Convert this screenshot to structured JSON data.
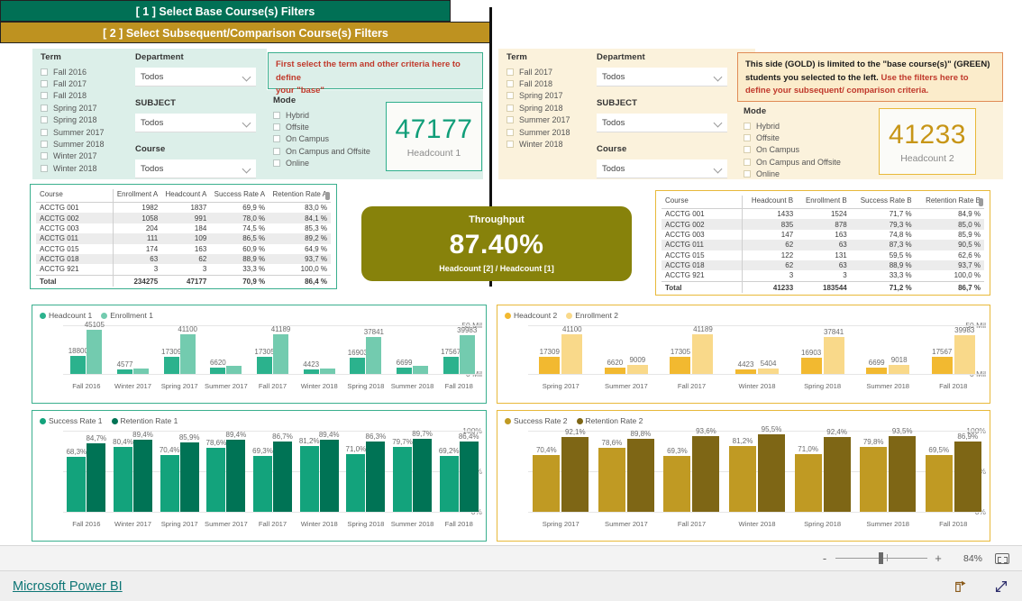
{
  "left_panel": {
    "header": "[ 1 ] Select Base Course(s) Filters",
    "term_label": "Term",
    "terms": [
      "Fall 2016",
      "Fall 2017",
      "Fall 2018",
      "Spring 2017",
      "Spring 2018",
      "Summer 2017",
      "Summer 2018",
      "Winter 2017",
      "Winter 2018"
    ],
    "department_label": "Department",
    "department_value": "Todos",
    "subject_label": "SUBJECT",
    "subject_value": "Todos",
    "course_label": "Course",
    "course_value": "Todos",
    "mode_label": "Mode",
    "modes": [
      "Hybrid",
      "Offsite",
      "On Campus",
      "On Campus and Offsite",
      "Online"
    ],
    "note_line1": "First select the term and other criteria here to define",
    "note_line2": "your \"base\"",
    "kpi_value": "47177",
    "kpi_caption": "Headcount 1"
  },
  "right_panel": {
    "header": "[ 2 ] Select Subsequent/Comparison Course(s) Filters",
    "term_label": "Term",
    "terms": [
      "Fall 2017",
      "Fall 2018",
      "Spring 2017",
      "Spring 2018",
      "Summer 2017",
      "Summer 2018",
      "Winter 2018"
    ],
    "department_label": "Department",
    "department_value": "Todos",
    "subject_label": "SUBJECT",
    "subject_value": "Todos",
    "course_label": "Course",
    "course_value": "Todos",
    "mode_label": "Mode",
    "modes": [
      "Hybrid",
      "Offsite",
      "On Campus",
      "On Campus and Offsite",
      "Online"
    ],
    "note_line1": "This side (GOLD) is limited to the \"base course(s)\" (GREEN)",
    "note_line2_a": "students you selected to the left.",
    "note_line2_b": "Use the filters here to",
    "note_line3": "define your subsequent/ comparison criteria.",
    "kpi_value": "41233",
    "kpi_caption": "Headcount 2"
  },
  "throughput": {
    "title": "Throughput",
    "value": "87.40%",
    "subtitle": "Headcount [2] / Headcount [1]"
  },
  "table_a": {
    "headers": [
      "Course",
      "Enrollment A",
      "Headcount A",
      "Success Rate A",
      "Retention Rate A"
    ],
    "rows": [
      [
        "ACCTG 001",
        "1982",
        "1837",
        "69,9 %",
        "83,0 %"
      ],
      [
        "ACCTG 002",
        "1058",
        "991",
        "78,0 %",
        "84,1 %"
      ],
      [
        "ACCTG 003",
        "204",
        "184",
        "74,5 %",
        "85,3 %"
      ],
      [
        "ACCTG 011",
        "111",
        "109",
        "86,5 %",
        "89,2 %"
      ],
      [
        "ACCTG 015",
        "174",
        "163",
        "60,9 %",
        "64,9 %"
      ],
      [
        "ACCTG 018",
        "63",
        "62",
        "88,9 %",
        "93,7 %"
      ],
      [
        "ACCTG 921",
        "3",
        "3",
        "33,3 %",
        "100,0 %"
      ]
    ],
    "total": [
      "Total",
      "234275",
      "47177",
      "70,9 %",
      "86,4 %"
    ]
  },
  "table_b": {
    "headers": [
      "Course",
      "Headcount B",
      "Enrollment B",
      "Success Rate B",
      "Retention Rate B"
    ],
    "rows": [
      [
        "ACCTG 001",
        "1433",
        "1524",
        "71,7 %",
        "84,9 %"
      ],
      [
        "ACCTG 002",
        "835",
        "878",
        "79,3 %",
        "85,0 %"
      ],
      [
        "ACCTG 003",
        "147",
        "163",
        "74,8 %",
        "85,9 %"
      ],
      [
        "ACCTG 011",
        "62",
        "63",
        "87,3 %",
        "90,5 %"
      ],
      [
        "ACCTG 015",
        "122",
        "131",
        "59,5 %",
        "62,6 %"
      ],
      [
        "ACCTG 018",
        "62",
        "63",
        "88,9 %",
        "93,7 %"
      ],
      [
        "ACCTG 921",
        "3",
        "3",
        "33,3 %",
        "100,0 %"
      ]
    ],
    "total": [
      "Total",
      "41233",
      "183544",
      "71,2 %",
      "86,7 %"
    ]
  },
  "status_bar": {
    "zoom_minus": "-",
    "zoom_plus": "+",
    "zoom_level": "84%"
  },
  "footer": {
    "brand": "Microsoft Power BI"
  },
  "colors": {
    "green_header": "#017055",
    "gold_header": "#BE9220",
    "green_fill_light": "#DCEFE9",
    "gold_fill_light": "#FBF2DC",
    "headcount1": "#2BB28D",
    "enrollment1": "#73CBAF",
    "headcount2": "#F2B930",
    "enrollment2": "#F9D98A",
    "success1": "#13A37C",
    "retention1": "#007355",
    "success2": "#C09A23",
    "retention2": "#7E6615",
    "throughput_bg": "#87820B"
  },
  "chart_data": [
    {
      "type": "bar",
      "title": "Headcount 1 / Enrollment 1",
      "categories": [
        "Fall 2016",
        "Winter 2017",
        "Spring 2017",
        "Summer 2017",
        "Fall 2017",
        "Winter 2018",
        "Spring 2018",
        "Summer 2018",
        "Fall 2018"
      ],
      "series": [
        {
          "name": "Headcount 1",
          "color": "#2BB28D",
          "values": [
            18800,
            4577,
            17309,
            6620,
            17305,
            4423,
            16903,
            6699,
            17567
          ]
        },
        {
          "name": "Enrollment 1",
          "color": "#73CBAF",
          "values": [
            45105,
            5400,
            41100,
            8100,
            41189,
            5300,
            37841,
            8100,
            39983
          ]
        }
      ],
      "visible_labels": {
        "Headcount 1": [
          "18800",
          "4577",
          "17309",
          "6620",
          "17305",
          "4423",
          "16903",
          "6699",
          "17567"
        ],
        "Enrollment 1": [
          "45105",
          "",
          "41100",
          "",
          "41189",
          "",
          "37841",
          "",
          "39983"
        ]
      },
      "ylabel": "",
      "xlabel": "",
      "yticks": [
        "0 Mil",
        "50 Mil"
      ],
      "ylim": [
        0,
        50000
      ],
      "grid": true,
      "legend": "top-left"
    },
    {
      "type": "bar",
      "title": "Headcount 2 / Enrollment 2",
      "categories": [
        "Spring 2017",
        "Summer 2017",
        "Fall 2017",
        "Winter 2018",
        "Spring 2018",
        "Summer 2018",
        "Fall 2018"
      ],
      "series": [
        {
          "name": "Headcount 2",
          "color": "#F2B930",
          "values": [
            17309,
            6620,
            17305,
            4423,
            16903,
            6699,
            17567
          ]
        },
        {
          "name": "Enrollment 2",
          "color": "#F9D98A",
          "values": [
            41100,
            9009,
            41189,
            5404,
            37841,
            9018,
            39983
          ]
        }
      ],
      "visible_labels": {
        "Headcount 2": [
          "17309",
          "6620",
          "17305",
          "4423",
          "16903",
          "6699",
          "17567"
        ],
        "Enrollment 2": [
          "41100",
          "9009",
          "41189",
          "5404",
          "37841",
          "9018",
          "39983"
        ]
      },
      "ylabel": "",
      "xlabel": "",
      "yticks": [
        "0 Mil",
        "50 Mil"
      ],
      "ylim": [
        0,
        50000
      ],
      "grid": true,
      "legend": "top-left"
    },
    {
      "type": "bar",
      "title": "Success Rate 1 / Retention Rate 1",
      "categories": [
        "Fall 2016",
        "Winter 2017",
        "Spring 2017",
        "Summer 2017",
        "Fall 2017",
        "Winter 2018",
        "Spring 2018",
        "Summer 2018",
        "Fall 2018"
      ],
      "series": [
        {
          "name": "Success Rate 1",
          "color": "#13A37C",
          "values": [
            68.3,
            80.4,
            70.4,
            78.6,
            69.3,
            81.2,
            71.0,
            79.7,
            69.2
          ]
        },
        {
          "name": "Retention Rate 1",
          "color": "#007355",
          "values": [
            84.7,
            89.4,
            85.9,
            89.4,
            86.7,
            89.4,
            86.3,
            89.7,
            86.4
          ]
        }
      ],
      "visible_labels": {
        "Success Rate 1": [
          "68,3%",
          "80,4%",
          "70,4%",
          "78,6%",
          "69,3%",
          "81,2%",
          "71,0%",
          "79,7%",
          "69,2%"
        ],
        "Retention Rate 1": [
          "84,7%",
          "89,4%",
          "85,9%",
          "89,4%",
          "86,7%",
          "89,4%",
          "86,3%",
          "89,7%",
          "86,4%"
        ]
      },
      "ylabel": "",
      "xlabel": "",
      "yticks": [
        "0%",
        "50%",
        "100%"
      ],
      "ylim": [
        0,
        100
      ],
      "grid": true,
      "legend": "top-left"
    },
    {
      "type": "bar",
      "title": "Success Rate 2 / Retention Rate 2",
      "categories": [
        "Spring 2017",
        "Summer 2017",
        "Fall 2017",
        "Winter 2018",
        "Spring 2018",
        "Summer 2018",
        "Fall 2018"
      ],
      "series": [
        {
          "name": "Success Rate 2",
          "color": "#C09A23",
          "values": [
            70.4,
            78.6,
            69.3,
            81.2,
            71.0,
            79.8,
            69.5
          ]
        },
        {
          "name": "Retention Rate 2",
          "color": "#7E6615",
          "values": [
            92.1,
            89.8,
            93.6,
            95.5,
            92.4,
            93.5,
            86.9
          ]
        }
      ],
      "visible_labels": {
        "Success Rate 2": [
          "70,4%",
          "78,6%",
          "69,3%",
          "81,2%",
          "71,0%",
          "79,8%",
          "69,5%"
        ],
        "Retention Rate 2": [
          "92,1%",
          "89,8%",
          "93,6%",
          "95,5%",
          "92,4%",
          "93,5%",
          "86,9%"
        ]
      },
      "ylabel": "",
      "xlabel": "",
      "yticks": [
        "0%",
        "50%",
        "100%"
      ],
      "ylim": [
        0,
        100
      ],
      "grid": true,
      "legend": "top-left"
    }
  ]
}
